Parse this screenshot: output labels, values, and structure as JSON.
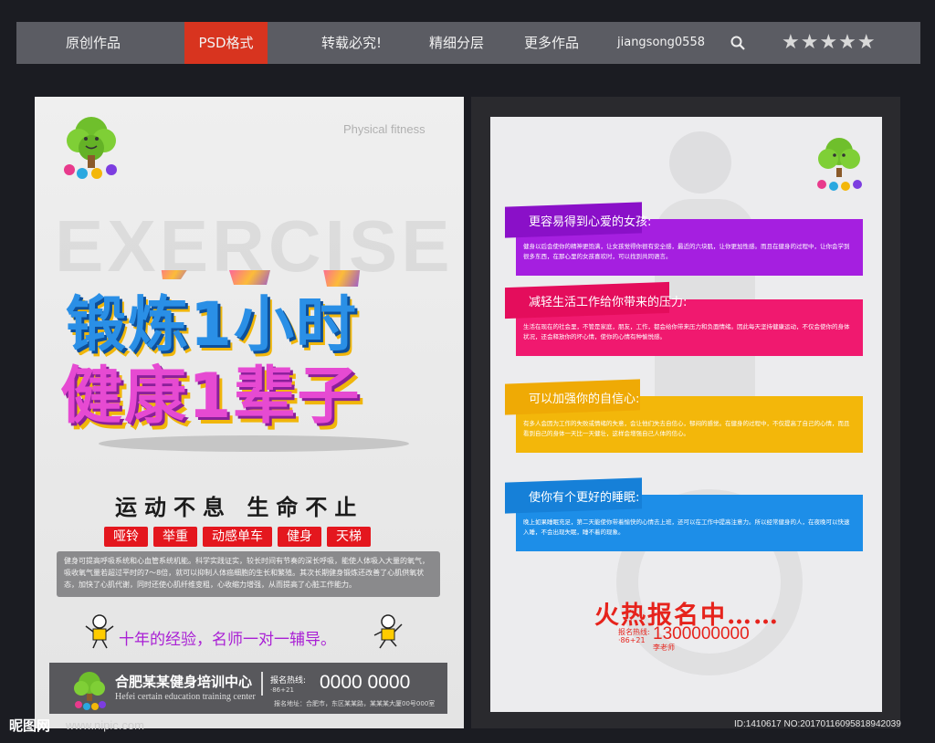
{
  "nav": {
    "items": [
      "原创作品",
      "PSD格式",
      "转载必究!",
      "精细分层",
      "更多作品"
    ],
    "active_index": 1,
    "user": "jiangsong0558",
    "rating_stars": 5,
    "rating_display": "★★★★★"
  },
  "left_poster": {
    "logo_text": "培训中心",
    "physical_text": "Physical fitness",
    "bg_word": "EXERCISE",
    "headline_line1": "锻炼1小时",
    "headline_line2": "健康1辈子",
    "slogan": "运动不息  生命不止",
    "tags": [
      "哑铃",
      "举重",
      "动感单车",
      "健身",
      "天梯"
    ],
    "description": "健身可提高呼吸系统和心血管系统机能。科学实践证实，较长时间有节奏的深长呼吸，能使人体吸入大量的氧气，吸收氧气量若超过平时的7～8倍，就可以抑制人体癌细胞的生长和繁殖。其次长期健身锻炼还改善了心肌供氧状态，加快了心肌代谢，同时还使心肌纤维变粗，心收缩力增强，从而提高了心脏工作能力。",
    "experience": "十年的经验，名师一对一辅导。",
    "footer": {
      "name": "合肥某某健身培训中心",
      "english": "Hefei certain education training center",
      "hotline_label": "报名热线:",
      "area_code": "·86+21",
      "phone": "0000 0000",
      "address": "报名地址：合肥市，东区某某路，某某某大厦00号000室"
    }
  },
  "right_poster": {
    "logo_text": "培训中心",
    "cards": [
      {
        "title": "更容易得到心爱的女孩:",
        "color": "#a51fe0",
        "text": "健身以后会使你的精神更饱满，让女孩觉得你很有安全感，最近的六块肌，让你更加性感。而且在健身的过程中，让你会学到很多东西，在那心里的女孩喜欢时，可以找到共同语言。"
      },
      {
        "title": "减轻生活工作给你带来的压力:",
        "color": "#f0196f",
        "text": "生活在现在的社会里，不管是家庭，朋友，工作，都会给你带来压力和负面情绪。因此每天坚持健康运动，不仅会使你的身体状况，还会释放你的坏心情，使你的心情有种愉悦感。"
      },
      {
        "title": "可以加强你的自信心:",
        "color": "#f3b70a",
        "text": "有多人会因为工作的失败或情绪的失意，会让他们失去自信心，郁闷的感觉。在健身的过程中，不仅提高了自己的心情，而且看到自己的身体一天比一天健壮，这样会增强自己人体的信心。"
      },
      {
        "title": "使你有个更好的睡眠:",
        "color": "#1d8ee8",
        "text": "晚上如果睡眠充足，第二天能使你带着愉快的心情去上班，还可以在工作中提高注意力。所以经常健身的人，在夜晚可以快速入睡，不会出现失眠，睡不着的现象。"
      }
    ],
    "hot_text": "火热报名中……",
    "hotline_label": "报名热线:",
    "area_code": "·86+21",
    "phone": "1300000000",
    "teacher": "李老师"
  },
  "watermark": {
    "left": "昵图网",
    "url": "www.nipic.com",
    "right": "ID:1410617 NO:20170116095818942039"
  },
  "colors": {
    "nav_bg": "#5b5c63",
    "nav_active": "#d8341f",
    "tag_red": "#e4171e"
  }
}
